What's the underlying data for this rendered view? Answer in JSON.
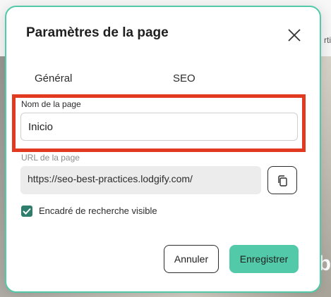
{
  "background": {
    "right_text": "rti",
    "right_big": "b"
  },
  "modal": {
    "title": "Paramètres de la page",
    "tabs": [
      {
        "label": "Général",
        "active": true
      },
      {
        "label": "SEO",
        "active": false
      }
    ],
    "name_field": {
      "label": "Nom de la page",
      "value": "Inicio"
    },
    "url_field": {
      "label": "URL de la page",
      "value": "https://seo-best-practices.lodgify.com/"
    },
    "checkbox": {
      "label": "Encadré de recherche visible",
      "checked": true
    },
    "buttons": {
      "cancel": "Annuler",
      "save": "Enregistrer"
    }
  },
  "colors": {
    "accent": "#52c9a8",
    "highlight": "#e23a21",
    "checkbox": "#2f7d6d"
  }
}
